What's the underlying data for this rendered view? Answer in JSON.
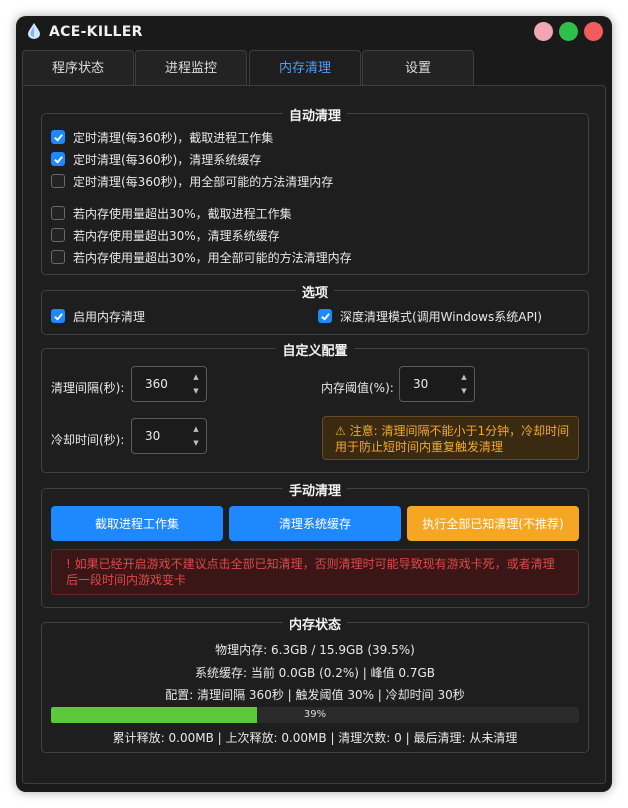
{
  "window": {
    "title": "ACE-KILLER",
    "icon": "water-drop-icon",
    "controls": [
      {
        "name": "minimize",
        "color": "#f4a6b4"
      },
      {
        "name": "maximize",
        "color": "#2fc04a"
      },
      {
        "name": "close",
        "color": "#f25c5c"
      }
    ]
  },
  "tabs": [
    {
      "label": "程序状态",
      "active": false
    },
    {
      "label": "进程监控",
      "active": false
    },
    {
      "label": "内存清理",
      "active": true
    },
    {
      "label": "设置",
      "active": false
    }
  ],
  "auto_clean": {
    "title": "自动清理",
    "items": [
      {
        "label": "定时清理(每360秒)，截取进程工作集",
        "checked": true
      },
      {
        "label": "定时清理(每360秒)，清理系统缓存",
        "checked": true
      },
      {
        "label": "定时清理(每360秒)，用全部可能的方法清理内存",
        "checked": false
      },
      {
        "label": "若内存使用量超出30%，截取进程工作集",
        "checked": false
      },
      {
        "label": "若内存使用量超出30%，清理系统缓存",
        "checked": false
      },
      {
        "label": "若内存使用量超出30%，用全部可能的方法清理内存",
        "checked": false
      }
    ]
  },
  "options": {
    "title": "选项",
    "enable": {
      "label": "启用内存清理",
      "checked": true
    },
    "deep": {
      "label": "深度清理模式(调用Windows系统API)",
      "checked": true
    }
  },
  "custom": {
    "title": "自定义配置",
    "interval_label": "清理间隔(秒):",
    "interval_value": "360",
    "threshold_label": "内存阈值(%):",
    "threshold_value": "30",
    "cooldown_label": "冷却时间(秒):",
    "cooldown_value": "30",
    "warning_icon": "warning-icon",
    "warning_line1": "注意: 清理间隔不能小于1分钟，冷却时间",
    "warning_line2": "用于防止短时间内重复触发清理"
  },
  "manual": {
    "title": "手动清理",
    "btn_trim": "截取进程工作集",
    "btn_cache": "清理系统缓存",
    "btn_all": "执行全部已知清理(不推荐)",
    "colors": {
      "primary": "#1e88ff",
      "warning": "#f5a623",
      "danger": "#e04848",
      "progress": "#5cc83a"
    },
    "danger_icon": "exclamation-icon",
    "danger_line1": "如果已经开启游戏不建议点击全部已知清理，否则清理时可能导致现有游戏卡死，或者清理",
    "danger_line2": "后一段时间内游戏变卡"
  },
  "status": {
    "title": "内存状态",
    "physical": "物理内存: 6.3GB / 15.9GB (39.5%)",
    "cache": "系统缓存: 当前 0.0GB (0.2%) | 峰值 0.7GB",
    "config": "配置: 清理间隔 360秒 | 触发阈值 30% | 冷却时间 30秒",
    "progress_value": 39,
    "progress_text": "39%",
    "summary": "累计释放: 0.00MB | 上次释放: 0.00MB | 清理次数: 0 | 最后清理: 从未清理"
  }
}
